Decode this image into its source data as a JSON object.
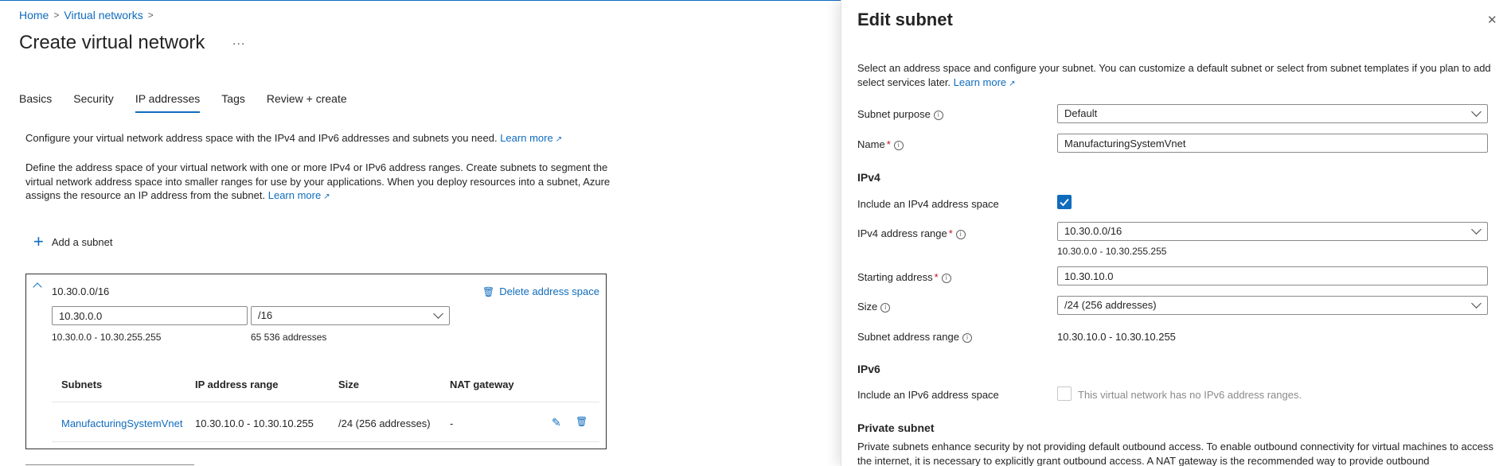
{
  "breadcrumb": {
    "items": [
      "Home",
      "Virtual networks"
    ]
  },
  "page_title": "Create virtual network",
  "more_label": "...",
  "tabs": [
    "Basics",
    "Security",
    "IP addresses",
    "Tags",
    "Review + create"
  ],
  "active_tab": "IP addresses",
  "intro": {
    "p1": "Configure your virtual network address space with the IPv4 and IPv6 addresses and subnets you need.",
    "p2": "Define the address space of your virtual network with one or more IPv4 or IPv6 address ranges. Create subnets to segment the virtual network address space into smaller ranges for use by your applications. When you deploy resources into a subnet, Azure assigns the resource an IP address from the subnet.",
    "learn_more": "Learn more"
  },
  "add_subnet_label": "Add a subnet",
  "address_space": {
    "title": "10.30.0.0/16",
    "delete_label": "Delete address space",
    "address_value": "10.30.0.0",
    "prefix_value": "/16",
    "range_text": "10.30.0.0 - 10.30.255.255",
    "count_text": "65 536 addresses",
    "columns": [
      "Subnets",
      "IP address range",
      "Size",
      "NAT gateway"
    ],
    "rows": [
      {
        "subnet": "ManufacturingSystemVnet",
        "range": "10.30.10.0 - 10.30.10.255",
        "size": "/24 (256 addresses)",
        "nat": "-"
      }
    ]
  },
  "panel": {
    "title": "Edit subnet",
    "close_label": "✕",
    "description": "Select an address space and configure your subnet. You can customize a default subnet or select from subnet templates if you plan to add select services later.",
    "learn_more": "Learn more",
    "subnet_purpose_label": "Subnet purpose",
    "subnet_purpose_value": "Default",
    "name_label": "Name",
    "name_value": "ManufacturingSystemVnet",
    "ipv4_heading": "IPv4",
    "include_ipv4_label": "Include an IPv4 address space",
    "include_ipv4_checked": true,
    "ipv4_range_label": "IPv4 address range",
    "ipv4_range_value": "10.30.0.0/16",
    "ipv4_range_hint": "10.30.0.0 - 10.30.255.255",
    "starting_address_label": "Starting address",
    "starting_address_value": "10.30.10.0",
    "size_label": "Size",
    "size_value": "/24 (256 addresses)",
    "subnet_range_label": "Subnet address range",
    "subnet_range_value": "10.30.10.0 - 10.30.10.255",
    "ipv6_heading": "IPv6",
    "include_ipv6_label": "Include an IPv6 address space",
    "include_ipv6_checked": false,
    "ipv6_note": "This virtual network has no IPv6 address ranges.",
    "private_heading": "Private subnet",
    "private_text": "Private subnets enhance security by not providing default outbound access. To enable outbound connectivity for virtual machines to access the internet, it is necessary to explicitly grant outbound access. A NAT gateway is the recommended way to provide outbound"
  },
  "colors": {
    "accent": "#0f6cbd",
    "required": "#c50f1f",
    "text": "#242424"
  }
}
